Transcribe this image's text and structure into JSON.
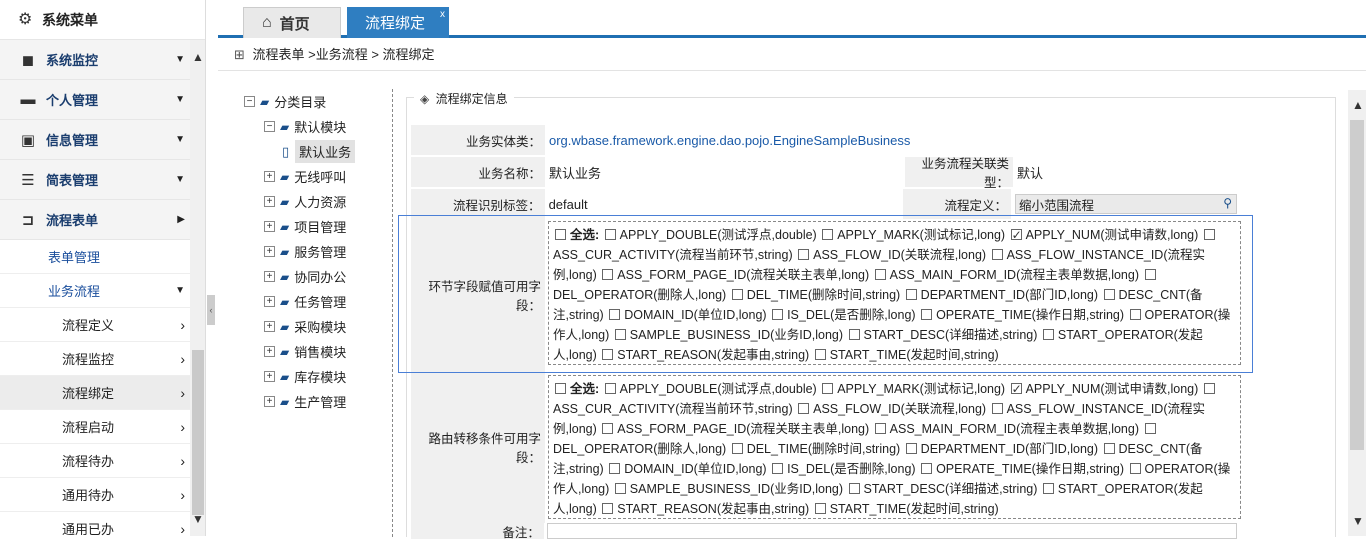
{
  "sidebar": {
    "title": "系统菜单",
    "items": [
      {
        "label": "系统监控",
        "icon": "cube-icon"
      },
      {
        "label": "个人管理",
        "icon": "briefcase-icon"
      },
      {
        "label": "信息管理",
        "icon": "window-icon"
      },
      {
        "label": "简表管理",
        "icon": "list-icon"
      },
      {
        "label": "流程表单",
        "icon": "inbox-icon"
      }
    ],
    "sub": [
      {
        "label": "表单管理"
      },
      {
        "label": "业务流程"
      }
    ],
    "subsub": [
      {
        "label": "流程定义"
      },
      {
        "label": "流程监控"
      },
      {
        "label": "流程绑定"
      },
      {
        "label": "流程启动"
      },
      {
        "label": "流程待办"
      },
      {
        "label": "通用待办"
      },
      {
        "label": "通用已办"
      }
    ]
  },
  "tabs": {
    "home": "首页",
    "active": "流程绑定",
    "close": "x"
  },
  "breadcrumb": "流程表单 >业务流程 > 流程绑定",
  "tree": {
    "root": "分类目录",
    "default_module": "默认模块",
    "default_business": "默认业务",
    "nodes": [
      "无线呼叫",
      "人力资源",
      "项目管理",
      "服务管理",
      "协同办公",
      "任务管理",
      "采购模块",
      "销售模块",
      "库存模块",
      "生产管理"
    ]
  },
  "form": {
    "legend": "流程绑定信息",
    "entity_label": "业务实体类：",
    "entity_value": "org.wbase.framework.engine.dao.pojo.EngineSampleBusiness",
    "name_label": "业务名称：",
    "name_value": "默认业务",
    "link_type_label": "业务流程关联类型：",
    "link_type_value": "默认",
    "tag_label": "流程识别标签：",
    "tag_value": "default",
    "def_label": "流程定义：",
    "def_value": "缩小范围流程",
    "group1_label": "环节字段赋值可用字段：",
    "group2_label": "路由转移条件可用字段：",
    "note_label": "备注：",
    "select_all": "全选:",
    "fields": [
      {
        "text": "APPLY_DOUBLE(测试浮点,double)",
        "checked": false
      },
      {
        "text": "APPLY_MARK(测试标记,long)",
        "checked": false
      },
      {
        "text": "APPLY_NUM(测试申请数,long)",
        "checked": true
      },
      {
        "text": "ASS_CUR_ACTIVITY(流程当前环节,string)",
        "checked": false
      },
      {
        "text": "ASS_FLOW_ID(关联流程,long)",
        "checked": false
      },
      {
        "text": "ASS_FLOW_INSTANCE_ID(流程实例,long)",
        "checked": false
      },
      {
        "text": "ASS_FORM_PAGE_ID(流程关联主表单,long)",
        "checked": false
      },
      {
        "text": "ASS_MAIN_FORM_ID(流程主表单数据,long)",
        "checked": false
      },
      {
        "text": "DEL_OPERATOR(删除人,long)",
        "checked": false
      },
      {
        "text": "DEL_TIME(删除时间,string)",
        "checked": false
      },
      {
        "text": "DEPARTMENT_ID(部门ID,long)",
        "checked": false
      },
      {
        "text": "DESC_CNT(备注,string)",
        "checked": false
      },
      {
        "text": "DOMAIN_ID(单位ID,long)",
        "checked": false
      },
      {
        "text": "IS_DEL(是否删除,long)",
        "checked": false
      },
      {
        "text": "OPERATE_TIME(操作日期,string)",
        "checked": false
      },
      {
        "text": "OPERATOR(操作人,long)",
        "checked": false
      },
      {
        "text": "SAMPLE_BUSINESS_ID(业务ID,long)",
        "checked": false
      },
      {
        "text": "START_DESC(详细描述,string)",
        "checked": false
      },
      {
        "text": "START_OPERATOR(发起人,long)",
        "checked": false
      },
      {
        "text": "START_REASON(发起事由,string)",
        "checked": false
      },
      {
        "text": "START_TIME(发起时间,string)",
        "checked": false
      }
    ]
  },
  "colors": {
    "accent": "#1f6fb2",
    "tab_active": "#2f7ec1",
    "link": "#1a5aa8",
    "highlight": "#4a7fd6"
  }
}
